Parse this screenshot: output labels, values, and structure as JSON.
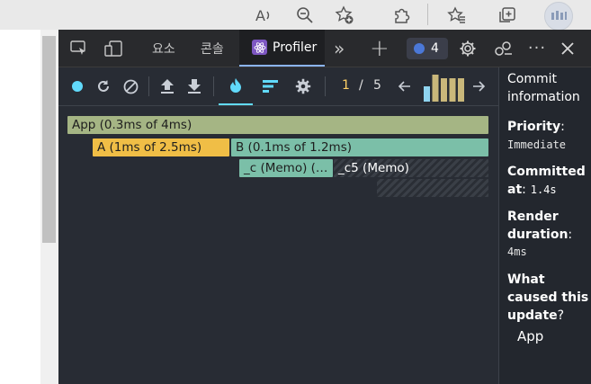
{
  "browser": {
    "icons": [
      "read-aloud-icon",
      "zoom-out-icon",
      "add-favorite-icon",
      "extensions-icon",
      "favorites-icon",
      "collections-icon",
      "profile-avatar"
    ]
  },
  "devtools": {
    "tabs": [
      {
        "label": "요소"
      },
      {
        "label": "콘솔"
      },
      {
        "label": "Profiler"
      }
    ],
    "more_label": "»",
    "add_label": "+",
    "issues_count": "4",
    "colors": {
      "profiler_tab_bg": "#1e1f22",
      "accent": "#61dafb"
    }
  },
  "profiler": {
    "commit_index": "1",
    "commit_separator": "/",
    "commit_total": "5",
    "commit_bars": [
      0.55,
      1.0,
      0.85,
      0.85,
      0.85
    ],
    "flamegraph": [
      {
        "label": "App (0.3ms of 4ms)",
        "color": "#a5b584"
      },
      {
        "label": "A (1ms of 2.5ms)",
        "color": "#f0be46"
      },
      {
        "label": "B (0.1ms of 1.2ms)",
        "color": "#7bbfa8"
      },
      {
        "label": "_c (Memo) (…",
        "color": "#7bbfa8"
      },
      {
        "label": "_c5 (Memo)",
        "color": "hatched"
      }
    ]
  },
  "commit_info": {
    "title": "Commit information",
    "priority_label": "Priority",
    "priority_value": "Immediate",
    "committed_label": "Committed at",
    "committed_value": "1.4s",
    "render_label": "Render duration",
    "render_value": "4ms",
    "cause_label": "What caused this update",
    "cause_value": "App"
  }
}
